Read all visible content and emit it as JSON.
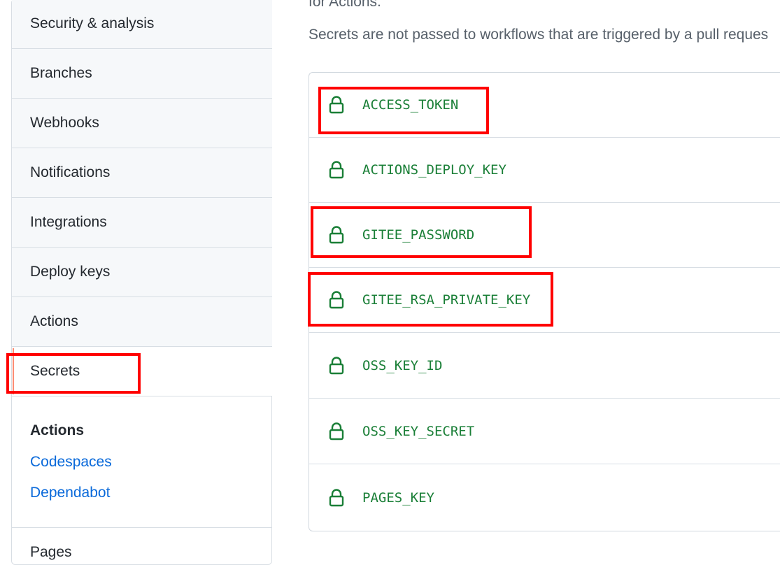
{
  "sidebar": {
    "items": [
      {
        "label": "Security & analysis"
      },
      {
        "label": "Branches"
      },
      {
        "label": "Webhooks"
      },
      {
        "label": "Notifications"
      },
      {
        "label": "Integrations"
      },
      {
        "label": "Deploy keys"
      },
      {
        "label": "Actions"
      },
      {
        "label": "Secrets",
        "selected": true
      }
    ],
    "secrets_group": {
      "title": "Actions",
      "links": [
        "Codespaces",
        "Dependabot"
      ]
    },
    "pages_label": "Pages"
  },
  "main": {
    "intro_fragment": "for Actions.",
    "note": "Secrets are not passed to workflows that are triggered by a pull reques",
    "secrets": [
      {
        "name": "ACCESS_TOKEN",
        "highlighted": true
      },
      {
        "name": "ACTIONS_DEPLOY_KEY",
        "highlighted": false
      },
      {
        "name": "GITEE_PASSWORD",
        "highlighted": true
      },
      {
        "name": "GITEE_RSA_PRIVATE_KEY",
        "highlighted": true
      },
      {
        "name": "OSS_KEY_ID",
        "highlighted": false
      },
      {
        "name": "OSS_KEY_SECRET",
        "highlighted": false
      },
      {
        "name": "PAGES_KEY",
        "highlighted": false
      }
    ]
  },
  "colors": {
    "secret_text": "#1a7f37",
    "link": "#0969da",
    "selected_marker": "#fd8c73",
    "annotation": "#ff0000"
  },
  "icons": {
    "secret": "lock-icon"
  }
}
